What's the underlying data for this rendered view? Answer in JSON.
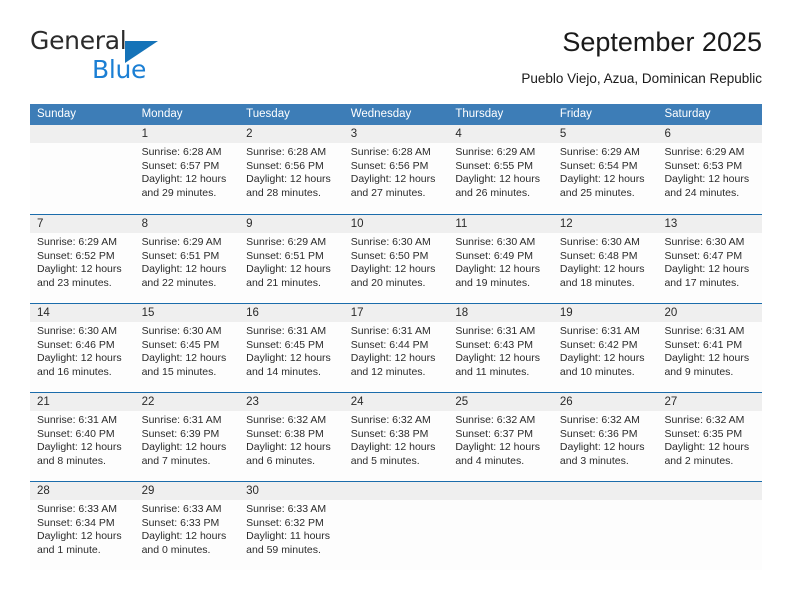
{
  "logo": {
    "word_top": "General",
    "word_bottom": "Blue",
    "accent_color": "#1573b8",
    "blue_text_color": "#1b7fd4"
  },
  "header": {
    "title": "September 2025",
    "subtitle": "Pueblo Viejo, Azua, Dominican Republic",
    "header_bg": "#3d7db7",
    "row_divider": "#1b6cab",
    "date_strip_bg": "#efefef"
  },
  "weekdays": [
    "Sunday",
    "Monday",
    "Tuesday",
    "Wednesday",
    "Thursday",
    "Friday",
    "Saturday"
  ],
  "weeks": [
    [
      {
        "day": "",
        "empty": true,
        "sunrise": "",
        "sunset": "",
        "daylight_a": "",
        "daylight_b": ""
      },
      {
        "day": "1",
        "sunrise": "Sunrise: 6:28 AM",
        "sunset": "Sunset: 6:57 PM",
        "daylight_a": "Daylight: 12 hours",
        "daylight_b": "and 29 minutes."
      },
      {
        "day": "2",
        "sunrise": "Sunrise: 6:28 AM",
        "sunset": "Sunset: 6:56 PM",
        "daylight_a": "Daylight: 12 hours",
        "daylight_b": "and 28 minutes."
      },
      {
        "day": "3",
        "sunrise": "Sunrise: 6:28 AM",
        "sunset": "Sunset: 6:56 PM",
        "daylight_a": "Daylight: 12 hours",
        "daylight_b": "and 27 minutes."
      },
      {
        "day": "4",
        "sunrise": "Sunrise: 6:29 AM",
        "sunset": "Sunset: 6:55 PM",
        "daylight_a": "Daylight: 12 hours",
        "daylight_b": "and 26 minutes."
      },
      {
        "day": "5",
        "sunrise": "Sunrise: 6:29 AM",
        "sunset": "Sunset: 6:54 PM",
        "daylight_a": "Daylight: 12 hours",
        "daylight_b": "and 25 minutes."
      },
      {
        "day": "6",
        "sunrise": "Sunrise: 6:29 AM",
        "sunset": "Sunset: 6:53 PM",
        "daylight_a": "Daylight: 12 hours",
        "daylight_b": "and 24 minutes."
      }
    ],
    [
      {
        "day": "7",
        "sunrise": "Sunrise: 6:29 AM",
        "sunset": "Sunset: 6:52 PM",
        "daylight_a": "Daylight: 12 hours",
        "daylight_b": "and 23 minutes."
      },
      {
        "day": "8",
        "sunrise": "Sunrise: 6:29 AM",
        "sunset": "Sunset: 6:51 PM",
        "daylight_a": "Daylight: 12 hours",
        "daylight_b": "and 22 minutes."
      },
      {
        "day": "9",
        "sunrise": "Sunrise: 6:29 AM",
        "sunset": "Sunset: 6:51 PM",
        "daylight_a": "Daylight: 12 hours",
        "daylight_b": "and 21 minutes."
      },
      {
        "day": "10",
        "sunrise": "Sunrise: 6:30 AM",
        "sunset": "Sunset: 6:50 PM",
        "daylight_a": "Daylight: 12 hours",
        "daylight_b": "and 20 minutes."
      },
      {
        "day": "11",
        "sunrise": "Sunrise: 6:30 AM",
        "sunset": "Sunset: 6:49 PM",
        "daylight_a": "Daylight: 12 hours",
        "daylight_b": "and 19 minutes."
      },
      {
        "day": "12",
        "sunrise": "Sunrise: 6:30 AM",
        "sunset": "Sunset: 6:48 PM",
        "daylight_a": "Daylight: 12 hours",
        "daylight_b": "and 18 minutes."
      },
      {
        "day": "13",
        "sunrise": "Sunrise: 6:30 AM",
        "sunset": "Sunset: 6:47 PM",
        "daylight_a": "Daylight: 12 hours",
        "daylight_b": "and 17 minutes."
      }
    ],
    [
      {
        "day": "14",
        "sunrise": "Sunrise: 6:30 AM",
        "sunset": "Sunset: 6:46 PM",
        "daylight_a": "Daylight: 12 hours",
        "daylight_b": "and 16 minutes."
      },
      {
        "day": "15",
        "sunrise": "Sunrise: 6:30 AM",
        "sunset": "Sunset: 6:45 PM",
        "daylight_a": "Daylight: 12 hours",
        "daylight_b": "and 15 minutes."
      },
      {
        "day": "16",
        "sunrise": "Sunrise: 6:31 AM",
        "sunset": "Sunset: 6:45 PM",
        "daylight_a": "Daylight: 12 hours",
        "daylight_b": "and 14 minutes."
      },
      {
        "day": "17",
        "sunrise": "Sunrise: 6:31 AM",
        "sunset": "Sunset: 6:44 PM",
        "daylight_a": "Daylight: 12 hours",
        "daylight_b": "and 12 minutes."
      },
      {
        "day": "18",
        "sunrise": "Sunrise: 6:31 AM",
        "sunset": "Sunset: 6:43 PM",
        "daylight_a": "Daylight: 12 hours",
        "daylight_b": "and 11 minutes."
      },
      {
        "day": "19",
        "sunrise": "Sunrise: 6:31 AM",
        "sunset": "Sunset: 6:42 PM",
        "daylight_a": "Daylight: 12 hours",
        "daylight_b": "and 10 minutes."
      },
      {
        "day": "20",
        "sunrise": "Sunrise: 6:31 AM",
        "sunset": "Sunset: 6:41 PM",
        "daylight_a": "Daylight: 12 hours",
        "daylight_b": "and 9 minutes."
      }
    ],
    [
      {
        "day": "21",
        "sunrise": "Sunrise: 6:31 AM",
        "sunset": "Sunset: 6:40 PM",
        "daylight_a": "Daylight: 12 hours",
        "daylight_b": "and 8 minutes."
      },
      {
        "day": "22",
        "sunrise": "Sunrise: 6:31 AM",
        "sunset": "Sunset: 6:39 PM",
        "daylight_a": "Daylight: 12 hours",
        "daylight_b": "and 7 minutes."
      },
      {
        "day": "23",
        "sunrise": "Sunrise: 6:32 AM",
        "sunset": "Sunset: 6:38 PM",
        "daylight_a": "Daylight: 12 hours",
        "daylight_b": "and 6 minutes."
      },
      {
        "day": "24",
        "sunrise": "Sunrise: 6:32 AM",
        "sunset": "Sunset: 6:38 PM",
        "daylight_a": "Daylight: 12 hours",
        "daylight_b": "and 5 minutes."
      },
      {
        "day": "25",
        "sunrise": "Sunrise: 6:32 AM",
        "sunset": "Sunset: 6:37 PM",
        "daylight_a": "Daylight: 12 hours",
        "daylight_b": "and 4 minutes."
      },
      {
        "day": "26",
        "sunrise": "Sunrise: 6:32 AM",
        "sunset": "Sunset: 6:36 PM",
        "daylight_a": "Daylight: 12 hours",
        "daylight_b": "and 3 minutes."
      },
      {
        "day": "27",
        "sunrise": "Sunrise: 6:32 AM",
        "sunset": "Sunset: 6:35 PM",
        "daylight_a": "Daylight: 12 hours",
        "daylight_b": "and 2 minutes."
      }
    ],
    [
      {
        "day": "28",
        "sunrise": "Sunrise: 6:33 AM",
        "sunset": "Sunset: 6:34 PM",
        "daylight_a": "Daylight: 12 hours",
        "daylight_b": "and 1 minute."
      },
      {
        "day": "29",
        "sunrise": "Sunrise: 6:33 AM",
        "sunset": "Sunset: 6:33 PM",
        "daylight_a": "Daylight: 12 hours",
        "daylight_b": "and 0 minutes."
      },
      {
        "day": "30",
        "sunrise": "Sunrise: 6:33 AM",
        "sunset": "Sunset: 6:32 PM",
        "daylight_a": "Daylight: 11 hours",
        "daylight_b": "and 59 minutes."
      },
      {
        "day": "",
        "empty": true,
        "sunrise": "",
        "sunset": "",
        "daylight_a": "",
        "daylight_b": ""
      },
      {
        "day": "",
        "empty": true,
        "sunrise": "",
        "sunset": "",
        "daylight_a": "",
        "daylight_b": ""
      },
      {
        "day": "",
        "empty": true,
        "sunrise": "",
        "sunset": "",
        "daylight_a": "",
        "daylight_b": ""
      },
      {
        "day": "",
        "empty": true,
        "sunrise": "",
        "sunset": "",
        "daylight_a": "",
        "daylight_b": ""
      }
    ]
  ]
}
